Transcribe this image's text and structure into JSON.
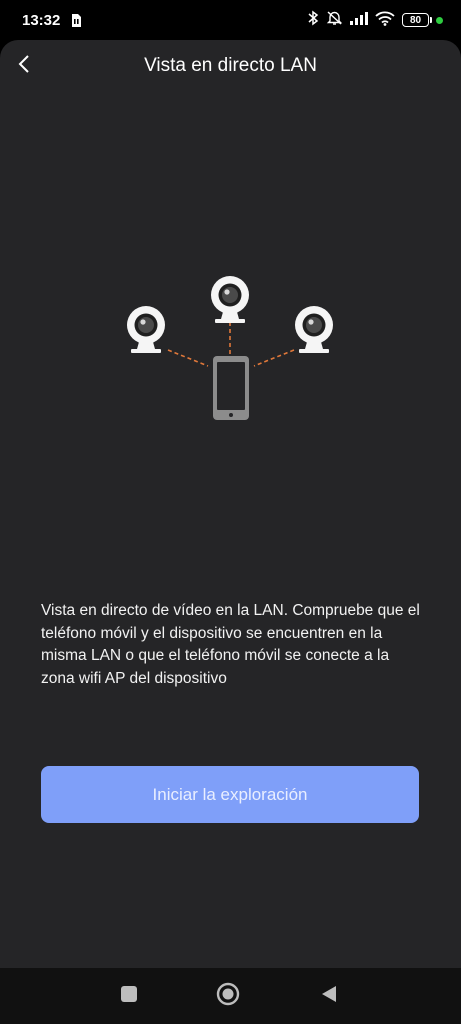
{
  "status_bar": {
    "time": "13:32",
    "battery": "80",
    "icons": [
      "sim-card-icon",
      "bluetooth-icon",
      "mute-icon",
      "signal-icon",
      "wifi-icon",
      "battery-icon",
      "notification-dot-icon"
    ]
  },
  "header": {
    "title": "Vista en directo LAN",
    "back_icon": "chevron-left-icon"
  },
  "illustration": {
    "icons": [
      "camera-icon",
      "camera-icon",
      "camera-icon",
      "smartphone-icon"
    ],
    "link_color": "#e0783a"
  },
  "main": {
    "description": "Vista en directo de vídeo en la LAN. Compruebe que el teléfono móvil y el dispositivo se encuentren en la misma LAN o que el teléfono móvil se conecte a la zona wifi AP del dispositivo",
    "start_button": "Iniciar la exploración"
  },
  "nav": {
    "icons": [
      "recents-square-icon",
      "home-circle-icon",
      "back-triangle-icon"
    ]
  },
  "colors": {
    "background": "#252527",
    "accent": "#7f9ff9"
  }
}
